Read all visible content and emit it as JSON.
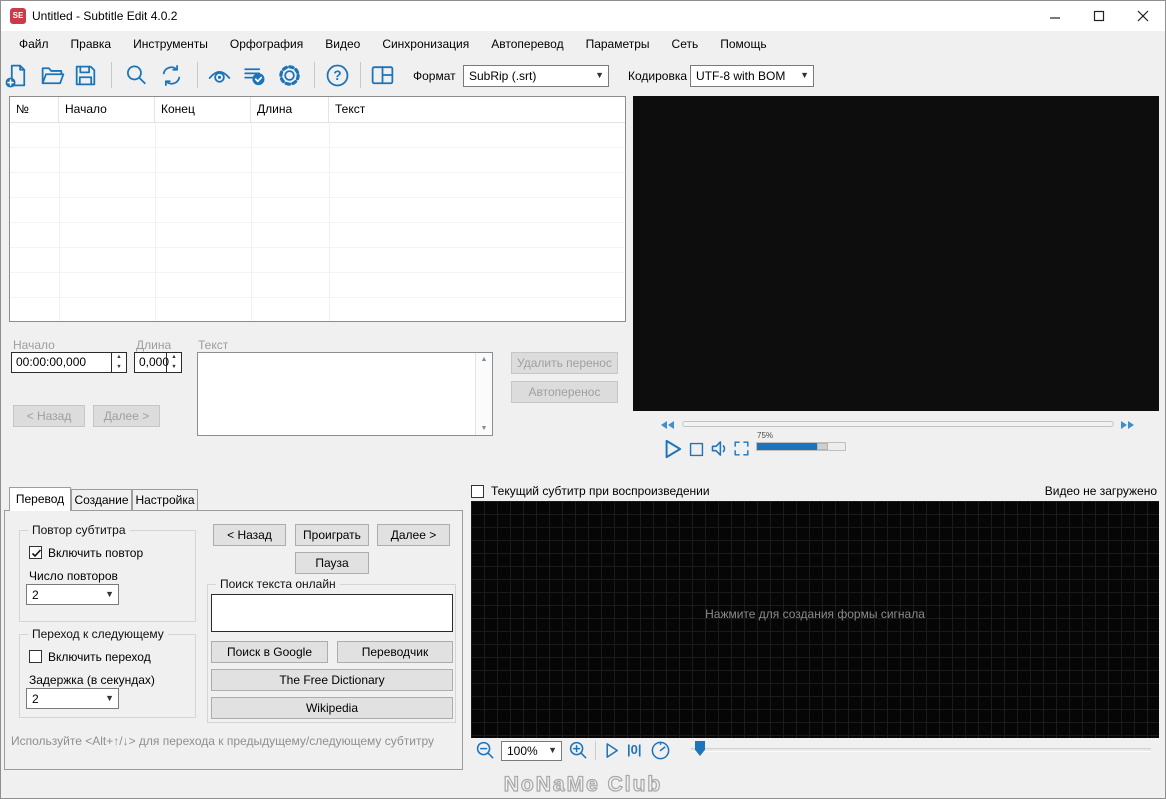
{
  "window": {
    "title": "Untitled - Subtitle Edit 4.0.2",
    "logo": "SE"
  },
  "menu": {
    "items": [
      "Файл",
      "Правка",
      "Инструменты",
      "Орфография",
      "Видео",
      "Синхронизация",
      "Автоперевод",
      "Параметры",
      "Сеть",
      "Помощь"
    ]
  },
  "toolbar": {
    "icons": [
      "new-file",
      "open-file",
      "save",
      "find",
      "replace",
      "visual-sync",
      "spell-check",
      "settings",
      "help",
      "layout"
    ],
    "format_label": "Формат",
    "format_value": "SubRip (.srt)",
    "encoding_label": "Кодировка",
    "encoding_value": "UTF-8 with BOM"
  },
  "subtitle_list": {
    "columns": [
      "№",
      "Начало",
      "Конец",
      "Длина",
      "Текст"
    ],
    "rows": []
  },
  "edit_panel": {
    "start_label": "Начало",
    "start_value": "00:00:00,000",
    "duration_label": "Длина",
    "duration_value": "0,000",
    "text_label": "Текст",
    "text_value": "",
    "back_button": "< Назад",
    "next_button": "Далее >",
    "remove_break_button": "Удалить перенос",
    "auto_break_button": "Автоперенос"
  },
  "video_player": {
    "volume": "75%",
    "status": "Видео не загружено"
  },
  "bottom_tabs": {
    "tabs": [
      "Перевод",
      "Создание",
      "Настройка"
    ],
    "active": "Перевод"
  },
  "translate_tab": {
    "repeat_group": {
      "title": "Повтор субтитра",
      "checkbox_label": "Включить повтор",
      "checkbox_checked": true,
      "count_label": "Число повторов",
      "count_value": "2"
    },
    "next_group": {
      "title": "Переход к следующему",
      "checkbox_label": "Включить переход",
      "checkbox_checked": false,
      "delay_label": "Задержка (в секундах)",
      "delay_value": "2"
    },
    "back_button": "< Назад",
    "play_button": "Проиграть",
    "next_button": "Далее >",
    "pause_button": "Пауза",
    "search_group": {
      "title": "Поиск текста онлайн",
      "input_value": "",
      "google_button": "Поиск в Google",
      "translator_button": "Переводчик",
      "dictionary_button": "The Free Dictionary",
      "wikipedia_button": "Wikipedia"
    },
    "hint": "Используйте <Alt+↑/↓> для перехода к предыдущему/следующему субтитру"
  },
  "waveform": {
    "current_subtitle_label": "Текущий субтитр при воспроизведении",
    "placeholder": "Нажмите для создания формы сигнала",
    "zoom_value": "100%",
    "zero_label": "|0|"
  },
  "watermark": "NoNaMe Club",
  "colors": {
    "accent": "#1c74b8",
    "video_bg": "#0d0d0d",
    "waveform_bg": "#060606",
    "logo_red": "#cb3b47"
  }
}
